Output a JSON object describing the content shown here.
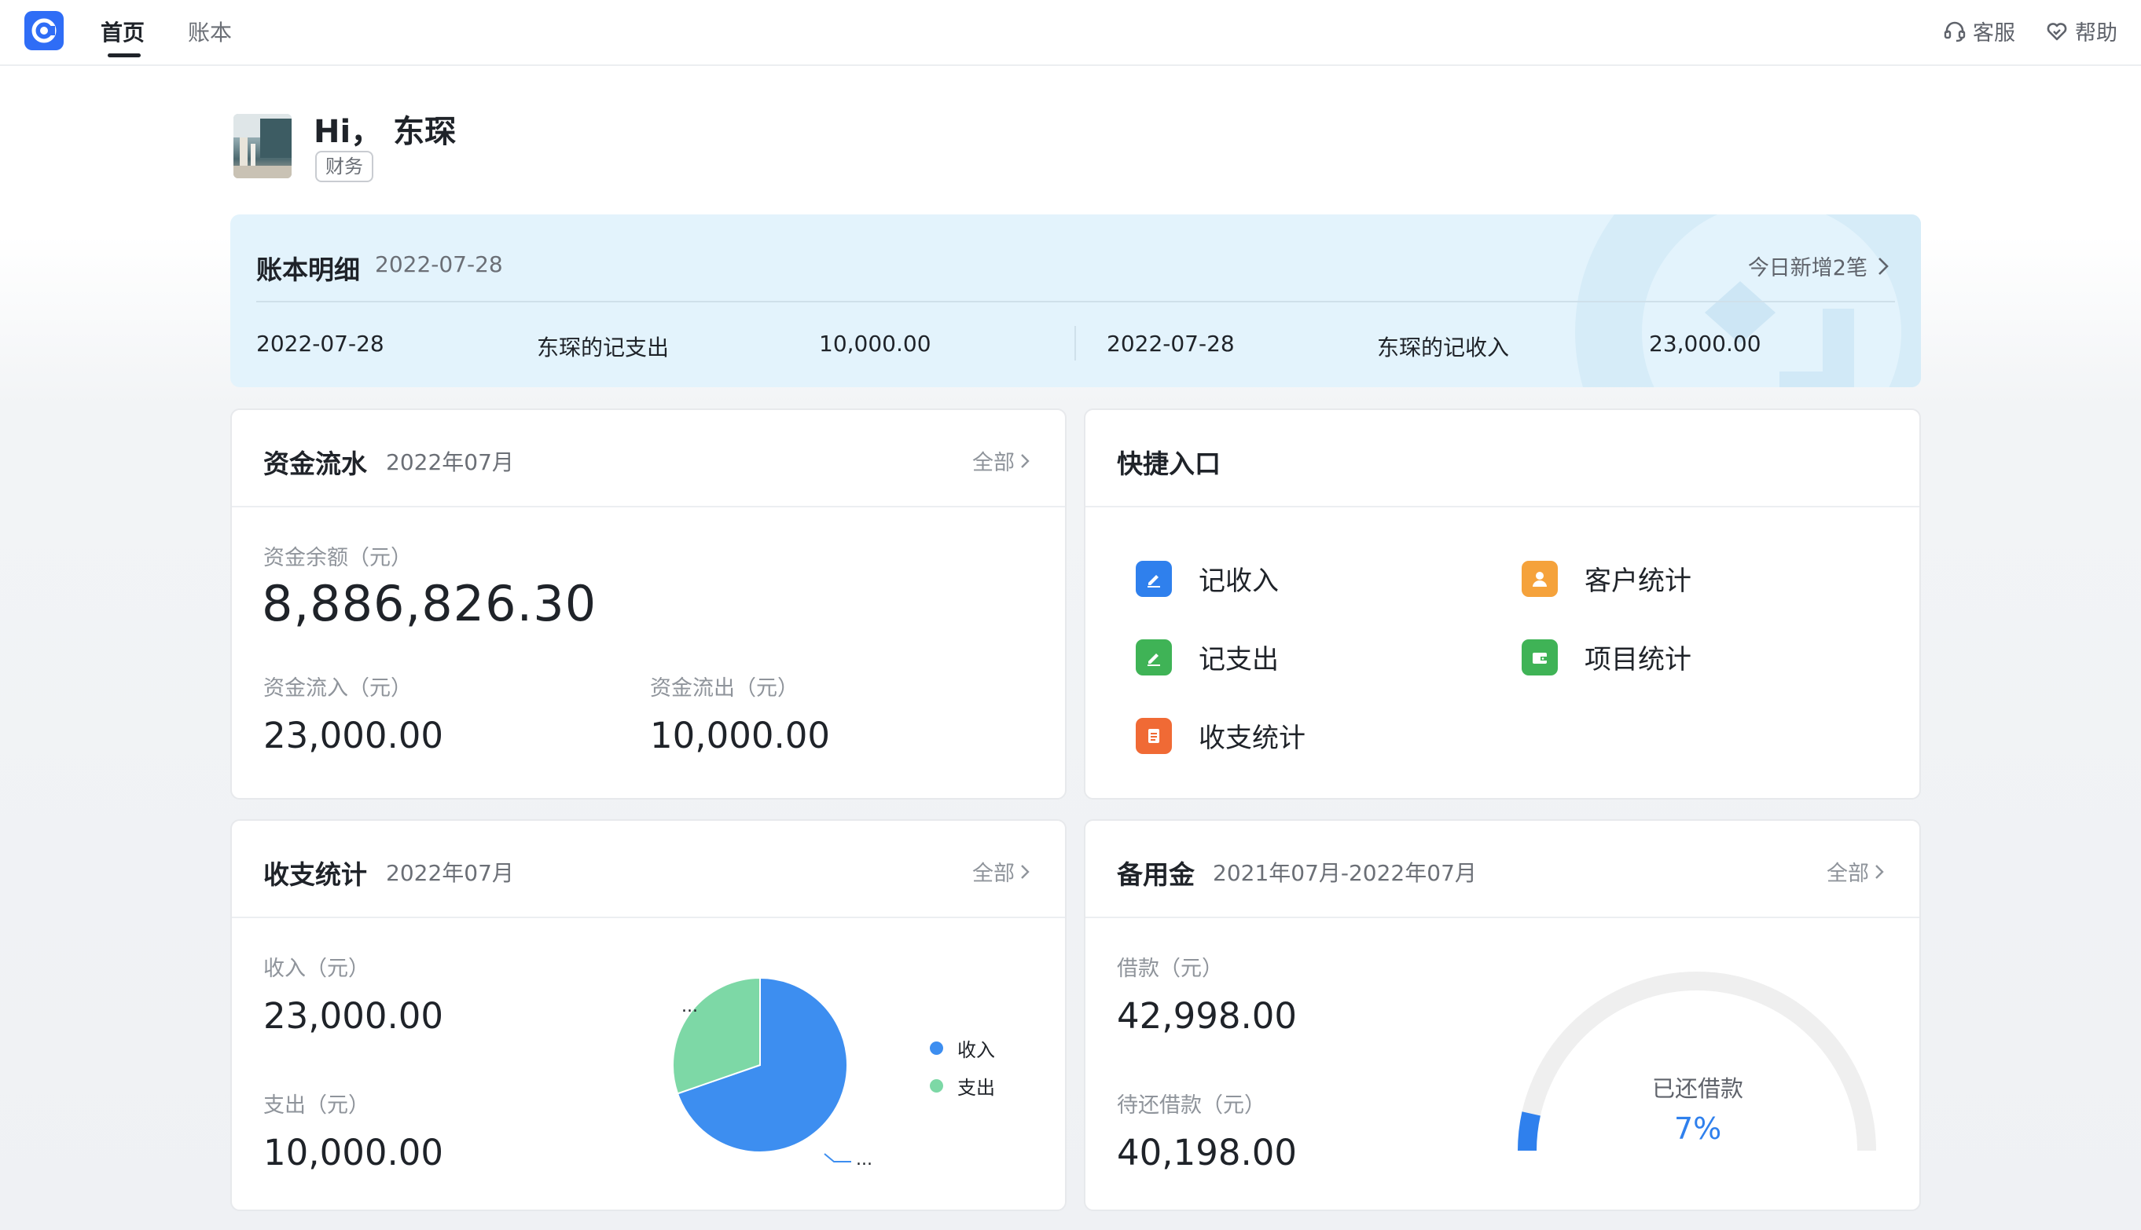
{
  "nav": {
    "tabs": [
      {
        "label": "首页",
        "active": true
      },
      {
        "label": "账本",
        "active": false
      }
    ],
    "service_label": "客服",
    "help_label": "帮助"
  },
  "profile": {
    "greeting": "Hi， 东琛",
    "role": "财务"
  },
  "ledger": {
    "title": "账本明细",
    "date": "2022-07-28",
    "link_label": "今日新增2笔",
    "entries": [
      {
        "date": "2022-07-28",
        "desc": "东琛的记支出",
        "amount": "10,000.00"
      },
      {
        "date": "2022-07-28",
        "desc": "东琛的记收入",
        "amount": "23,000.00"
      }
    ]
  },
  "cashflow": {
    "title": "资金流水",
    "period": "2022年07月",
    "more_label": "全部",
    "balance_label": "资金余额（元）",
    "balance_value": "8,886,826.30",
    "inflow_label": "资金流入（元）",
    "inflow_value": "23,000.00",
    "outflow_label": "资金流出（元）",
    "outflow_value": "10,000.00"
  },
  "quick": {
    "title": "快捷入口",
    "items": [
      {
        "label": "记收入",
        "icon": "edit-icon",
        "color": "#2f80ed"
      },
      {
        "label": "客户统计",
        "icon": "user-icon",
        "color": "#f5a23b"
      },
      {
        "label": "记支出",
        "icon": "edit-icon",
        "color": "#3fb356"
      },
      {
        "label": "项目统计",
        "icon": "wallet-icon",
        "color": "#3fb356"
      },
      {
        "label": "收支统计",
        "icon": "document-icon",
        "color": "#f06a35"
      }
    ]
  },
  "income_stats": {
    "title": "收支统计",
    "period": "2022年07月",
    "more_label": "全部",
    "income_label": "收入（元）",
    "income_value": "23,000.00",
    "expense_label": "支出（元）",
    "expense_value": "10,000.00",
    "pie_label_top": "...",
    "pie_label_bottom": "..."
  },
  "reserve": {
    "title": "备用金",
    "period": "2021年07月-2022年07月",
    "more_label": "全部",
    "loan_label": "借款（元）",
    "loan_value": "42,998.00",
    "pending_label": "待还借款（元）",
    "pending_value": "40,198.00",
    "gauge_label": "已还借款",
    "gauge_value": "7%"
  },
  "chart_data": [
    {
      "type": "pie",
      "title": "",
      "categories": [
        "收入",
        "支出"
      ],
      "values": [
        23000,
        10000
      ],
      "colors": [
        "#3d8ef0",
        "#7dd8a6"
      ],
      "legend": "right"
    },
    {
      "type": "gauge",
      "title": "已还借款",
      "value": 7,
      "max": 100,
      "unit": "%",
      "color": "#2f80ed",
      "track_color": "#efefef"
    }
  ]
}
